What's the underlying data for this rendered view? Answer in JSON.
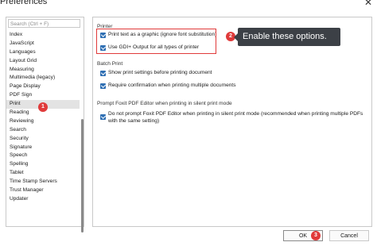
{
  "window": {
    "title": "Preferences",
    "close_glyph": "✕"
  },
  "sidebar": {
    "search_placeholder": "Search (Ctrl + F)",
    "items": [
      {
        "label": "Index"
      },
      {
        "label": "JavaScript"
      },
      {
        "label": "Languages"
      },
      {
        "label": "Layout Grid"
      },
      {
        "label": "Measuring"
      },
      {
        "label": "Multimedia (legacy)"
      },
      {
        "label": "Page Display"
      },
      {
        "label": "PDF Sign"
      },
      {
        "label": "Print",
        "selected": true
      },
      {
        "label": "Reading"
      },
      {
        "label": "Reviewing"
      },
      {
        "label": "Search"
      },
      {
        "label": "Security"
      },
      {
        "label": "Signature"
      },
      {
        "label": "Speech"
      },
      {
        "label": "Spelling"
      },
      {
        "label": "Tablet"
      },
      {
        "label": "Time Stamp Servers"
      },
      {
        "label": "Trust Manager"
      },
      {
        "label": "Updater"
      }
    ]
  },
  "panel": {
    "printer": {
      "title": "Printer",
      "options": [
        {
          "label": "Print text as a graphic (ignore font substitution)",
          "checked": true
        },
        {
          "label": "Use GDI+ Output for all types of printer",
          "checked": true
        }
      ]
    },
    "batch": {
      "title": "Batch Print",
      "options": [
        {
          "label": "Show print settings before printing document",
          "checked": true
        },
        {
          "label": "Require confirmation when printing multiple documents",
          "checked": true
        }
      ]
    },
    "prompt": {
      "title": "Prompt Foxit PDF Editor when printing in silent print mode",
      "option": {
        "label": "Do not prompt Foxit PDF Editor when printing in silent print mode (recommended when printing multiple PDFs with the same setting)",
        "checked": true
      }
    }
  },
  "annotations": {
    "badge1": "1",
    "badge2": "2",
    "badge3": "3",
    "callout": "Enable these options.",
    "accent": "#e03a3a"
  },
  "buttons": {
    "ok": "OK",
    "cancel": "Cancel"
  }
}
